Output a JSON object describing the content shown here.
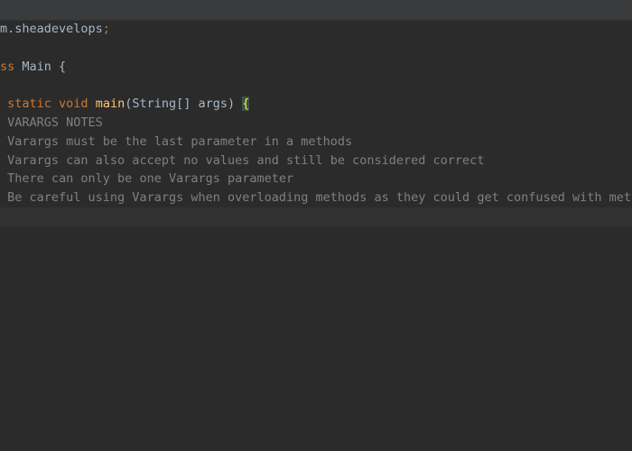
{
  "editor": {
    "lines": [
      {
        "parts": [
          "",
          "m.sheadevelops",
          ";"
        ]
      },
      {
        "parts": []
      },
      {
        "parts": [
          "ss",
          " Main {"
        ]
      },
      {
        "parts": []
      },
      {
        "parts": [
          "static void",
          "main",
          "(String[] args) ",
          "{"
        ]
      },
      {
        "text": "VARARGS NOTES"
      },
      {
        "text": "Varargs must be the last parameter in a methods"
      },
      {
        "text": "Varargs can also accept no values and still be considered correct"
      },
      {
        "text": "There can only be one Varargs parameter"
      },
      {
        "text": "Be careful using Varargs when overloading methods as they could get confused with method si"
      },
      {
        "text": ""
      }
    ]
  }
}
